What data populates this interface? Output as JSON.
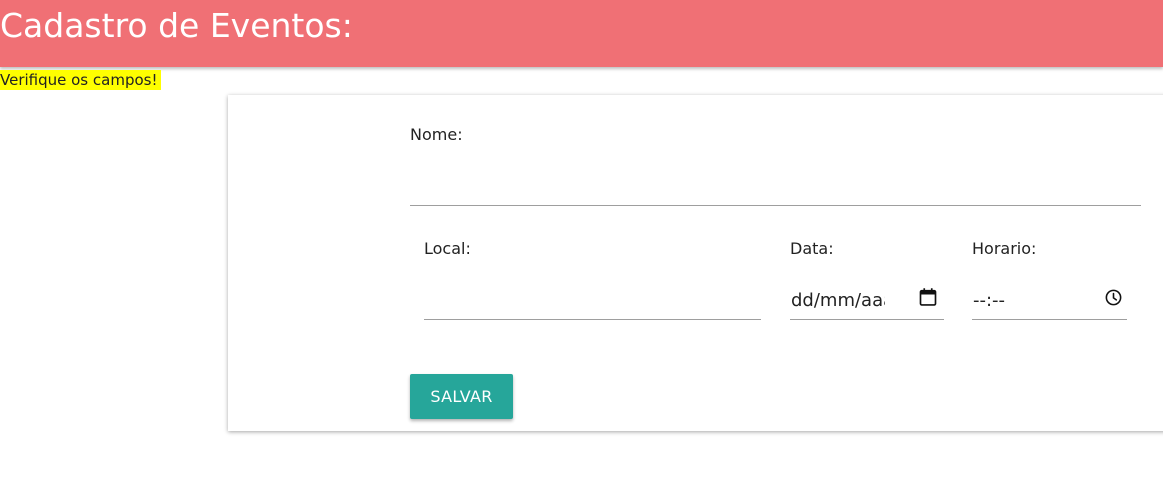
{
  "header": {
    "title": "Cadastro de Eventos:",
    "background_color": "#f07075"
  },
  "alert": {
    "text": "Verifique os campos!",
    "highlight_color": "#ffff00"
  },
  "form": {
    "nome": {
      "label": "Nome:",
      "value": ""
    },
    "local": {
      "label": "Local:",
      "value": ""
    },
    "data": {
      "label": "Data:",
      "value": "dd/mm/aaaa",
      "icon": "calendar-icon"
    },
    "horario": {
      "label": "Horario:",
      "value": "--:--",
      "icon": "clock-icon"
    },
    "submit": {
      "label": "SALVAR",
      "color": "#26a69a"
    }
  }
}
